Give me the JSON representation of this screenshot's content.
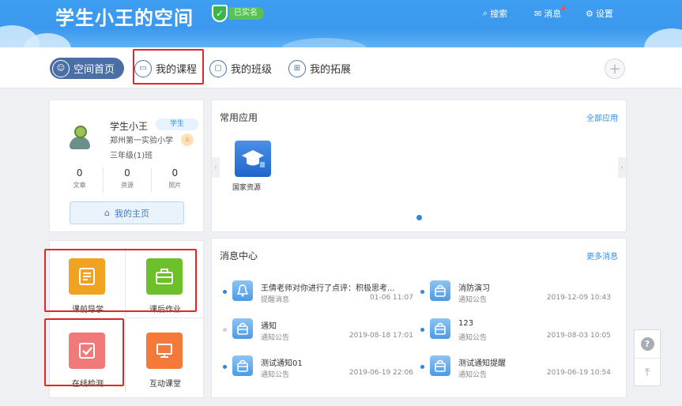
{
  "header": {
    "title": "学生小王的空间",
    "verified_label": "已实名",
    "search_label": "搜索",
    "messages_label": "消息",
    "settings_label": "设置"
  },
  "tabs": [
    {
      "label": "空间首页",
      "icon": "user-icon",
      "active": true
    },
    {
      "label": "我的课程",
      "icon": "course-icon",
      "active": false
    },
    {
      "label": "我的班级",
      "icon": "class-icon",
      "active": false
    },
    {
      "label": "我的拓展",
      "icon": "extension-icon",
      "active": false
    }
  ],
  "profile": {
    "name": "学生小王",
    "role": "学生",
    "school": "郑州第一实验小学",
    "class": "三年级(1)班",
    "stats": [
      {
        "value": "0",
        "label": "文章"
      },
      {
        "value": "0",
        "label": "资源"
      },
      {
        "value": "0",
        "label": "照片"
      }
    ],
    "home_button": "我的主页"
  },
  "apps": {
    "title": "常用应用",
    "all_link": "全部应用",
    "items": [
      {
        "label": "国家资源",
        "icon": "graduation-cap-icon"
      }
    ]
  },
  "quick": [
    {
      "label": "课前导学",
      "color": "#f0a321",
      "icon": "document-icon"
    },
    {
      "label": "课后作业",
      "color": "#6cc12b",
      "icon": "briefcase-icon"
    },
    {
      "label": "在线检测",
      "color": "#f07a7a",
      "icon": "checkbox-icon"
    },
    {
      "label": "互动课堂",
      "color": "#f57a3a",
      "icon": "monitor-icon"
    }
  ],
  "messages": {
    "title": "消息中心",
    "more_link": "更多消息",
    "items": [
      {
        "title": "王倩老师对你进行了点评：积极思考...",
        "type": "提醒消息",
        "time": "01-06 11:07",
        "icon": "bell-icon",
        "unread": true
      },
      {
        "title": "消防演习",
        "type": "通知公告",
        "time": "2019-12-09 10:43",
        "icon": "bag-icon",
        "unread": true
      },
      {
        "title": "通知",
        "type": "通知公告",
        "time": "2019-08-18 17:01",
        "icon": "bag-icon",
        "unread": false
      },
      {
        "title": "123",
        "type": "通知公告",
        "time": "2019-08-03 10:05",
        "icon": "bag-icon",
        "unread": true
      },
      {
        "title": "测试通知01",
        "type": "通知公告",
        "time": "2019-06-19 22:06",
        "icon": "bag-icon",
        "unread": true
      },
      {
        "title": "测试通知提醒",
        "type": "通知公告",
        "time": "2019-06-19 10:54",
        "icon": "bag-icon",
        "unread": true
      }
    ]
  },
  "colors": {
    "header_blue": "#3e9ef0",
    "tab_active": "#4a6fa5",
    "link_blue": "#3a8ee6",
    "highlight_red": "#e32626"
  }
}
